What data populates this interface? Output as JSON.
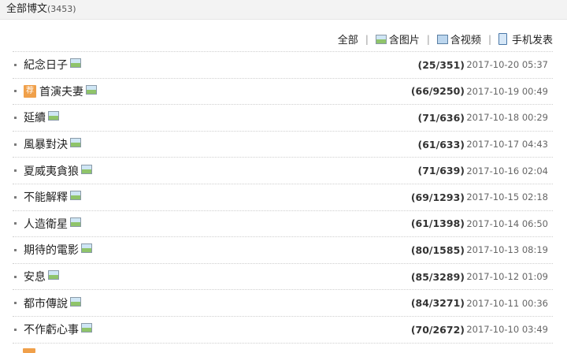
{
  "header": {
    "title": "全部博文",
    "count": "(3453)"
  },
  "filters": [
    {
      "label": "全部",
      "icon": ""
    },
    {
      "label": "含图片",
      "icon": "picture-icon"
    },
    {
      "label": "含视频",
      "icon": "video-icon"
    },
    {
      "label": "手机发表",
      "icon": "phone-icon"
    }
  ],
  "posts": [
    {
      "title": "紀念日子",
      "recommended": false,
      "stats": "(25/351)",
      "date": "2017-10-20 05:37"
    },
    {
      "title": "首演夫妻",
      "recommended": true,
      "rec_label": "荐",
      "stats": "(66/9250)",
      "date": "2017-10-19 00:49"
    },
    {
      "title": "延續",
      "recommended": false,
      "stats": "(71/636)",
      "date": "2017-10-18 00:29"
    },
    {
      "title": "風暴對決",
      "recommended": false,
      "stats": "(61/633)",
      "date": "2017-10-17 04:43"
    },
    {
      "title": "夏威夷貪狼",
      "recommended": false,
      "stats": "(71/639)",
      "date": "2017-10-16 02:04"
    },
    {
      "title": "不能解釋",
      "recommended": false,
      "stats": "(69/1293)",
      "date": "2017-10-15 02:18"
    },
    {
      "title": "人造衛星",
      "recommended": false,
      "stats": "(61/1398)",
      "date": "2017-10-14 06:50"
    },
    {
      "title": "期待的電影",
      "recommended": false,
      "stats": "(80/1585)",
      "date": "2017-10-13 08:19"
    },
    {
      "title": "安息",
      "recommended": false,
      "stats": "(85/3289)",
      "date": "2017-10-12 01:09"
    },
    {
      "title": "都市傳說",
      "recommended": false,
      "stats": "(84/3271)",
      "date": "2017-10-11 00:36"
    },
    {
      "title": "不作虧心事",
      "recommended": false,
      "stats": "(70/2672)",
      "date": "2017-10-10 03:49"
    }
  ]
}
